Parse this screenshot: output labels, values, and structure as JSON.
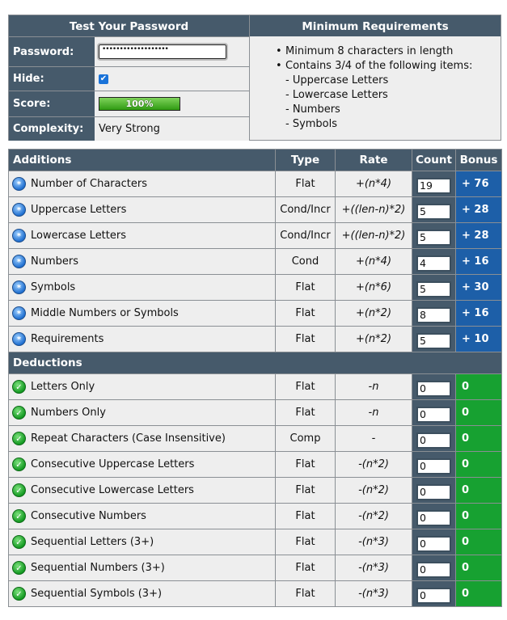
{
  "panel": {
    "title": "Test Your Password",
    "requirements_title": "Minimum Requirements",
    "password_label": "Password:",
    "password_value": "•••••••••••••••••••",
    "hide_label": "Hide:",
    "hide_checked": true,
    "hide_check_glyph": "✔",
    "score_label": "Score:",
    "score_value": "100%",
    "score_fraction": 1.0,
    "complexity_label": "Complexity:",
    "complexity_value": "Very Strong",
    "requirements": [
      {
        "text": "Minimum 8 characters in length",
        "bullet": true
      },
      {
        "text": "Contains 3/4 of the following items:",
        "bullet": true
      },
      {
        "text": "- Uppercase Letters",
        "bullet": false
      },
      {
        "text": "- Lowercase Letters",
        "bullet": false
      },
      {
        "text": "- Numbers",
        "bullet": false
      },
      {
        "text": "- Symbols",
        "bullet": false
      }
    ]
  },
  "table": {
    "headers": {
      "additions": "Additions",
      "type": "Type",
      "rate": "Rate",
      "count": "Count",
      "bonus": "Bonus"
    },
    "deductions_header": "Deductions",
    "additions": [
      {
        "name": "Number of Characters",
        "type": "Flat",
        "rate": "+(n*4)",
        "count": "19",
        "bonus": "+ 76"
      },
      {
        "name": "Uppercase Letters",
        "type": "Cond/Incr",
        "rate": "+((len-n)*2)",
        "count": "5",
        "bonus": "+ 28"
      },
      {
        "name": "Lowercase Letters",
        "type": "Cond/Incr",
        "rate": "+((len-n)*2)",
        "count": "5",
        "bonus": "+ 28"
      },
      {
        "name": "Numbers",
        "type": "Cond",
        "rate": "+(n*4)",
        "count": "4",
        "bonus": "+ 16"
      },
      {
        "name": "Symbols",
        "type": "Flat",
        "rate": "+(n*6)",
        "count": "5",
        "bonus": "+ 30"
      },
      {
        "name": "Middle Numbers or Symbols",
        "type": "Flat",
        "rate": "+(n*2)",
        "count": "8",
        "bonus": "+ 16"
      },
      {
        "name": "Requirements",
        "type": "Flat",
        "rate": "+(n*2)",
        "count": "5",
        "bonus": "+ 10"
      }
    ],
    "deductions": [
      {
        "name": "Letters Only",
        "type": "Flat",
        "rate": "-n",
        "count": "0",
        "bonus": "0"
      },
      {
        "name": "Numbers Only",
        "type": "Flat",
        "rate": "-n",
        "count": "0",
        "bonus": "0"
      },
      {
        "name": "Repeat Characters (Case Insensitive)",
        "type": "Comp",
        "rate": "-",
        "count": "0",
        "bonus": "0"
      },
      {
        "name": "Consecutive Uppercase Letters",
        "type": "Flat",
        "rate": "-(n*2)",
        "count": "0",
        "bonus": "0"
      },
      {
        "name": "Consecutive Lowercase Letters",
        "type": "Flat",
        "rate": "-(n*2)",
        "count": "0",
        "bonus": "0"
      },
      {
        "name": "Consecutive Numbers",
        "type": "Flat",
        "rate": "-(n*2)",
        "count": "0",
        "bonus": "0"
      },
      {
        "name": "Sequential Letters (3+)",
        "type": "Flat",
        "rate": "-(n*3)",
        "count": "0",
        "bonus": "0"
      },
      {
        "name": "Sequential Numbers (3+)",
        "type": "Flat",
        "rate": "-(n*3)",
        "count": "0",
        "bonus": "0"
      },
      {
        "name": "Sequential Symbols (3+)",
        "type": "Flat",
        "rate": "-(n*3)",
        "count": "0",
        "bonus": "0"
      }
    ]
  },
  "icons": {
    "addition_row": "info-icon",
    "deduction_row": "check-circle-icon"
  },
  "colors": {
    "header_bg": "#465a6b",
    "cell_bg": "#eeeeee",
    "bonus_add": "#1d5fa8",
    "bonus_ded": "#17a131",
    "score_bar": "#2f9a12"
  }
}
